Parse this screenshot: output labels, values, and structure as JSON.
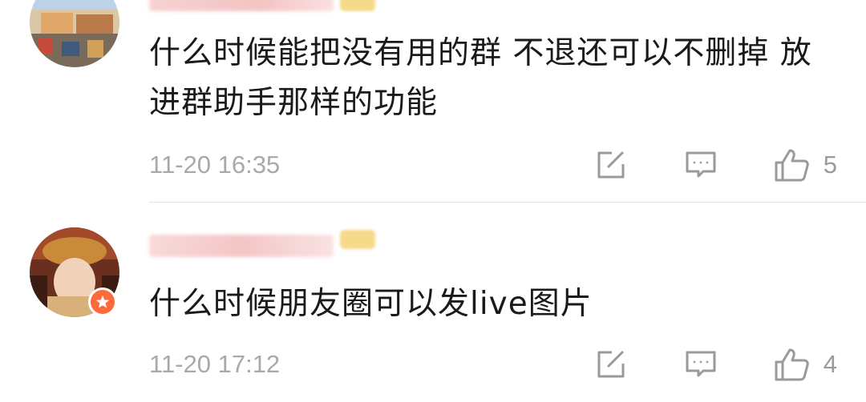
{
  "comments": [
    {
      "text": "什么时候能把没有用的群 不退还可以不删掉 放进群助手那样的功能",
      "time": "11-20 16:35",
      "likes": "5"
    },
    {
      "text": "什么时候朋友圈可以发live图片",
      "time": "11-20 17:12",
      "likes": "4"
    }
  ],
  "icons": {
    "share": "share-edit-icon",
    "reply": "comment-bubble-icon",
    "like": "thumbs-up-icon",
    "vip": "vip-star-icon"
  },
  "colors": {
    "text": "#1a1a1a",
    "meta": "#a9a9a9",
    "vip_badge": "#ff6a3d"
  }
}
